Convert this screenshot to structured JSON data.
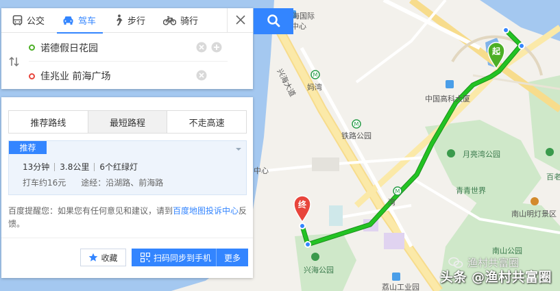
{
  "search": {
    "modes": [
      {
        "label": "公交",
        "icon": "bus-icon"
      },
      {
        "label": "驾车",
        "icon": "car-icon",
        "active": true
      },
      {
        "label": "步行",
        "icon": "walk-icon"
      },
      {
        "label": "骑行",
        "icon": "bike-icon"
      }
    ],
    "start": "诺德假日花园",
    "end": "佳兆业 前海广场"
  },
  "result": {
    "tabs": [
      "推荐路线",
      "最短路程",
      "不走高速"
    ],
    "active_tab": 1,
    "badge": "推荐",
    "duration": "13分钟",
    "distance": "3.8公里",
    "lights": "6个红绿灯",
    "taxi": "打车约16元",
    "via": "途经：沿湖路、前海路",
    "tip_prefix": "百度提醒您：如果您有任何意见和建议，请到",
    "tip_link": "百度地图投诉中心",
    "tip_suffix": "反馈。",
    "fav_label": "收藏",
    "scan_label": "扫码同步到手机",
    "more_label": "更多"
  },
  "map": {
    "labels": {
      "intl": "海国际",
      "center1": "中心",
      "road": "兴海大道",
      "mawan": "妈湾",
      "tielu": "铁路公园",
      "gaoke": "中国高科大厦",
      "yueliang": "月亮湾公园",
      "qingqing": "青青世界",
      "baiqiu": "百老",
      "center2": "中心",
      "wan": "湾",
      "xinghai": "兴海公园",
      "nanshan": "南山公园",
      "nanshan_view": "南山明灯景区",
      "industry": "荔山工业园"
    },
    "start_marker": "起",
    "end_marker": "终",
    "colors": {
      "route": "#1dbf1d",
      "accent": "#3385ff",
      "water": "#a4c8f0"
    }
  },
  "watermark": {
    "small": "渔村共富圈",
    "main": "头条 @渔村共富圈"
  }
}
